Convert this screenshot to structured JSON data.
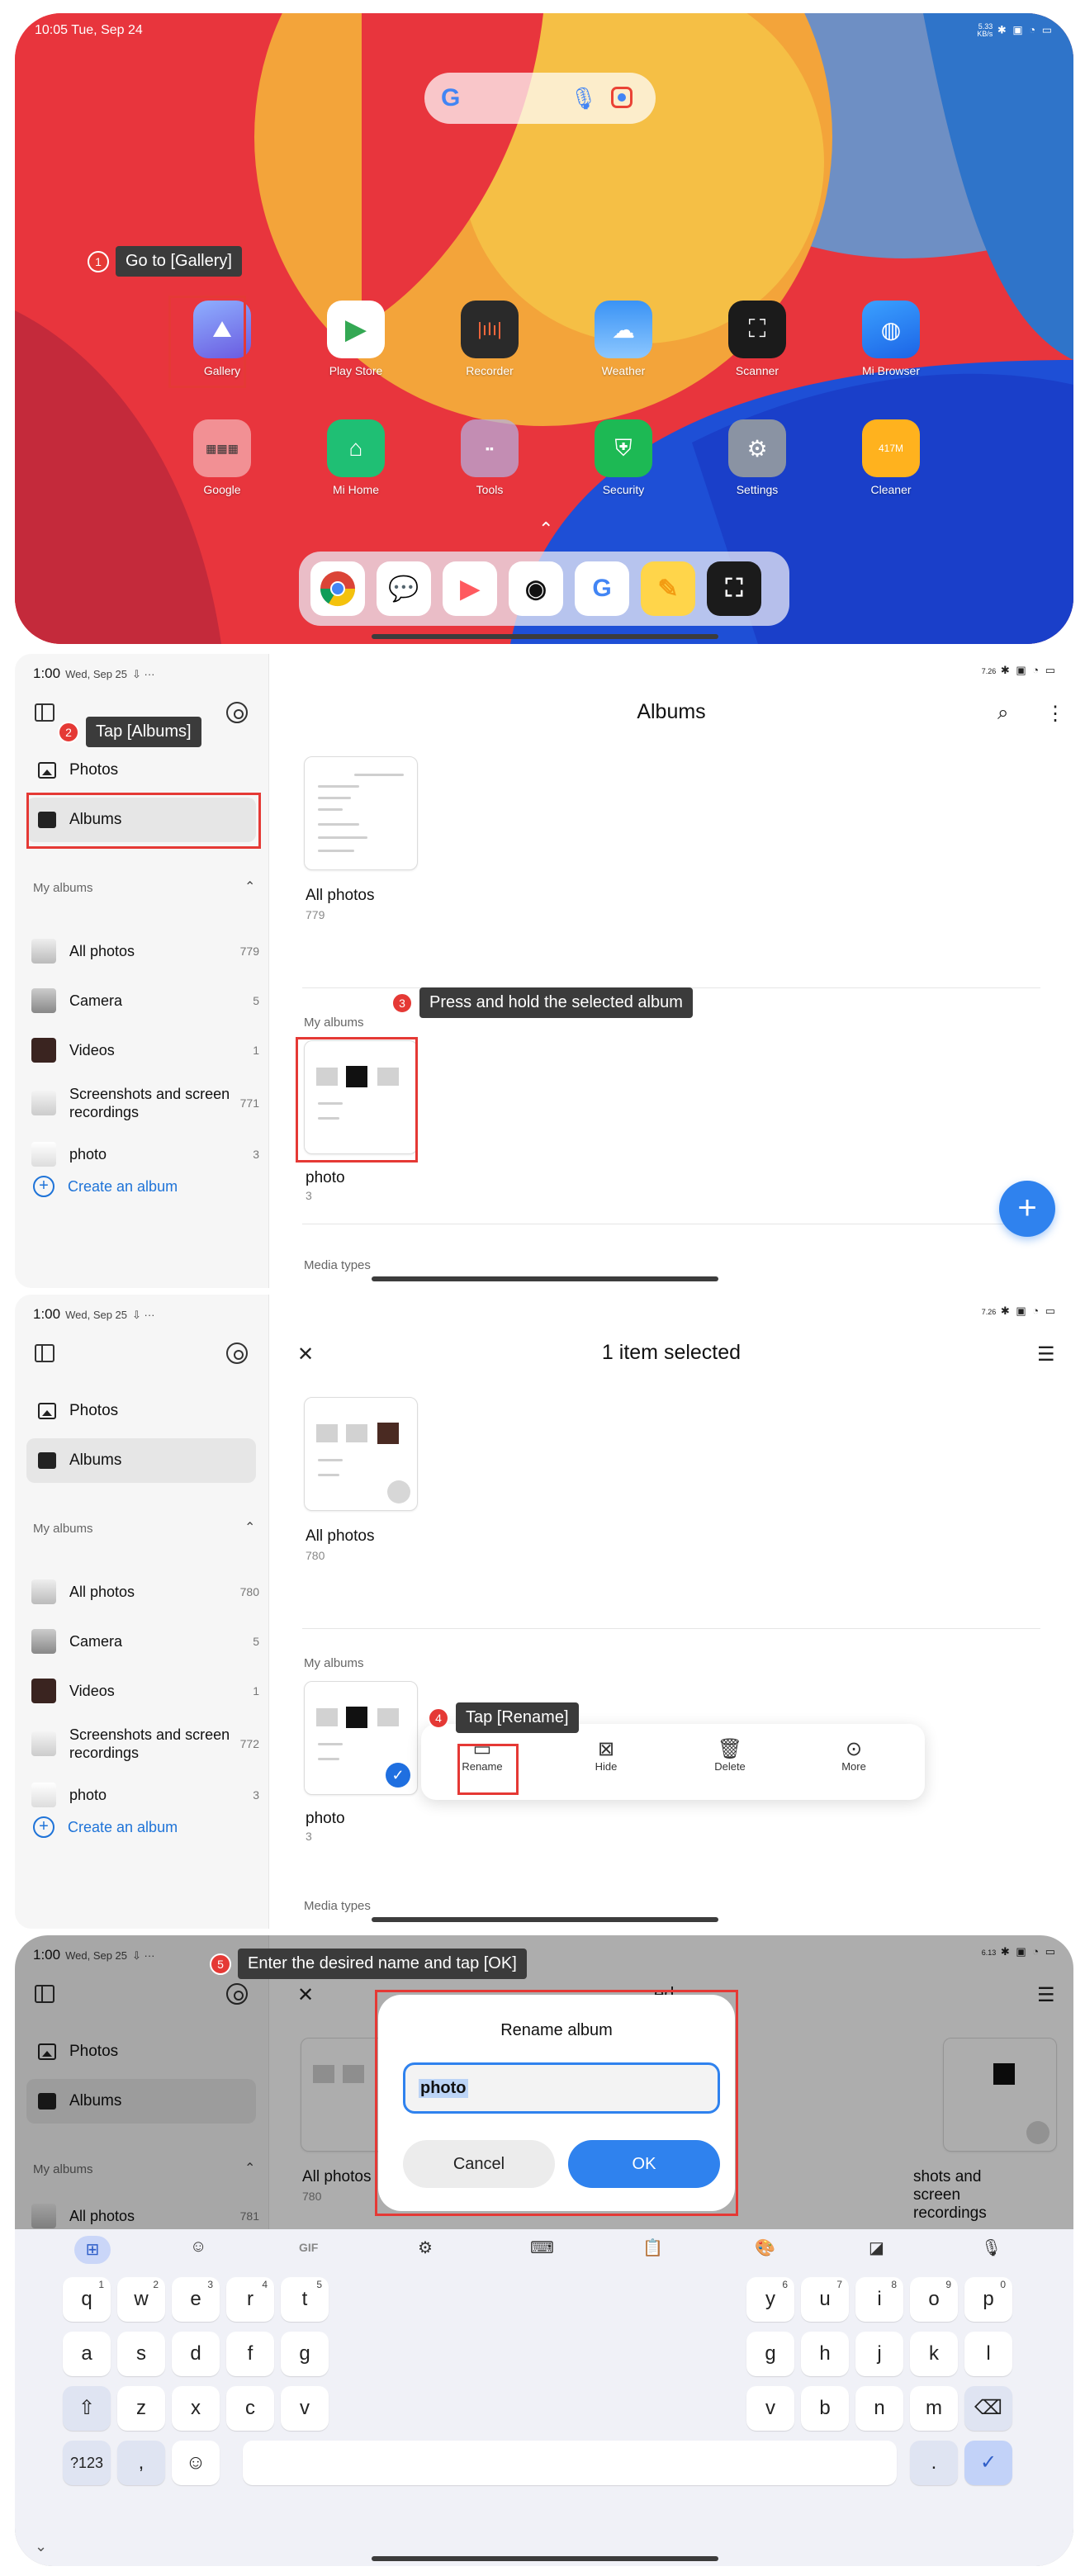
{
  "home": {
    "status_time": "10:05  Tue, Sep 24",
    "status_speed_top": "5.33",
    "status_speed_unit": "KB/s",
    "apps": [
      {
        "label": "Gallery"
      },
      {
        "label": "Play Store"
      },
      {
        "label": "Recorder"
      },
      {
        "label": "Weather"
      },
      {
        "label": "Scanner"
      },
      {
        "label": "Mi Browser"
      },
      {
        "label": "Google"
      },
      {
        "label": "Mi Home"
      },
      {
        "label": "Tools"
      },
      {
        "label": "Security"
      },
      {
        "label": "Settings"
      },
      {
        "label": "Cleaner"
      }
    ],
    "cleaner_badge": "417M"
  },
  "steps": [
    {
      "num": "1",
      "text": "Go to [Gallery]"
    },
    {
      "num": "2",
      "text": "Tap [Albums]"
    },
    {
      "num": "3",
      "text": "Press and hold the selected album"
    },
    {
      "num": "4",
      "text": "Tap [Rename]"
    },
    {
      "num": "5",
      "text": "Enter the desired name and tap [OK]"
    }
  ],
  "gallery": {
    "status_time": "1:00",
    "status_date": "Wed, Sep 25",
    "status_speed_2": "7.26",
    "status_speed_3": "7.26",
    "status_speed_4": "6.13",
    "status_unit": "KB/s",
    "nav_photos": "Photos",
    "nav_albums": "Albums",
    "my_albums_title": "My albums",
    "albums_title": "Albums",
    "selected_title": "1 item selected",
    "create_album": "Create an album",
    "media_types": "Media types",
    "sidebar_albums_s2": [
      {
        "name": "All photos",
        "count": "779"
      },
      {
        "name": "Camera",
        "count": "5"
      },
      {
        "name": "Videos",
        "count": "1"
      },
      {
        "name": "Screenshots and screen recordings",
        "count": "771"
      },
      {
        "name": "photo",
        "count": "3"
      }
    ],
    "sidebar_albums_s3": [
      {
        "name": "All photos",
        "count": "780"
      },
      {
        "name": "Camera",
        "count": "5"
      },
      {
        "name": "Videos",
        "count": "1"
      },
      {
        "name": "Screenshots and screen recordings",
        "count": "772"
      },
      {
        "name": "photo",
        "count": "3"
      }
    ],
    "sidebar_albums_s4": [
      {
        "name": "All photos",
        "count": "781"
      }
    ],
    "tile_all_photos": "All photos",
    "tile_all_count_2": "779",
    "tile_all_count_3": "780",
    "tile_all_count_4": "780",
    "tile_photo": "photo",
    "tile_photo_count": "3",
    "tile_screenshots_bg": "shots and screen recordings",
    "title_bg_4": "ed",
    "actions": [
      {
        "label": "Rename",
        "icon": "rename-icon"
      },
      {
        "label": "Hide",
        "icon": "hide-icon"
      },
      {
        "label": "Delete",
        "icon": "trash-icon"
      },
      {
        "label": "More",
        "icon": "more-icon"
      }
    ]
  },
  "dialog": {
    "title": "Rename album",
    "input_value": "photo",
    "cancel": "Cancel",
    "ok": "OK"
  },
  "keyboard": {
    "row1": [
      {
        "k": "q",
        "s": "1"
      },
      {
        "k": "w",
        "s": "2"
      },
      {
        "k": "e",
        "s": "3"
      },
      {
        "k": "r",
        "s": "4"
      },
      {
        "k": "t",
        "s": "5"
      },
      {
        "k": "y",
        "s": "6"
      },
      {
        "k": "u",
        "s": "7"
      },
      {
        "k": "i",
        "s": "8"
      },
      {
        "k": "o",
        "s": "9"
      },
      {
        "k": "p",
        "s": "0"
      }
    ],
    "row2": [
      "a",
      "s",
      "d",
      "f",
      "g",
      "g",
      "h",
      "j",
      "k",
      "l"
    ],
    "row3": [
      "z",
      "x",
      "c",
      "v",
      "v",
      "b",
      "n",
      "m"
    ],
    "sym": "?123",
    "comma": ",",
    "period": ".",
    "gif": "GIF"
  },
  "colors": {
    "accent": "#2f82ee",
    "callout": "#e53935"
  }
}
